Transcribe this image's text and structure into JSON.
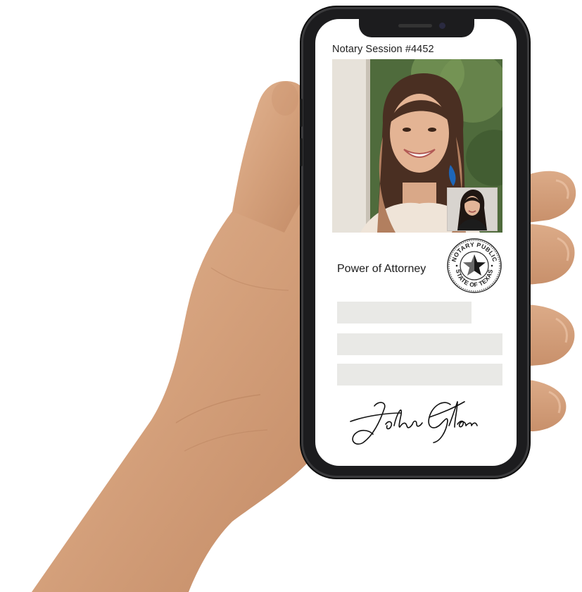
{
  "session": {
    "title": "Notary Session #4452"
  },
  "document": {
    "title": "Power of Attorney"
  },
  "seal": {
    "text_top": "NOTARY PUBLIC",
    "text_bottom": "STATE OF TEXAS"
  },
  "signature": {
    "text": "John Glenn"
  },
  "text_placeholders": [
    {
      "name": "placeholder-line-1"
    },
    {
      "name": "placeholder-line-2"
    },
    {
      "name": "placeholder-line-3"
    }
  ],
  "colors": {
    "phone_frame": "#1c1c1e",
    "screen_bg": "#ffffff",
    "placeholder": "#e9e9e6",
    "skin": "#d6a37f"
  },
  "icons": [
    "notary-seal-icon",
    "star-icon"
  ]
}
